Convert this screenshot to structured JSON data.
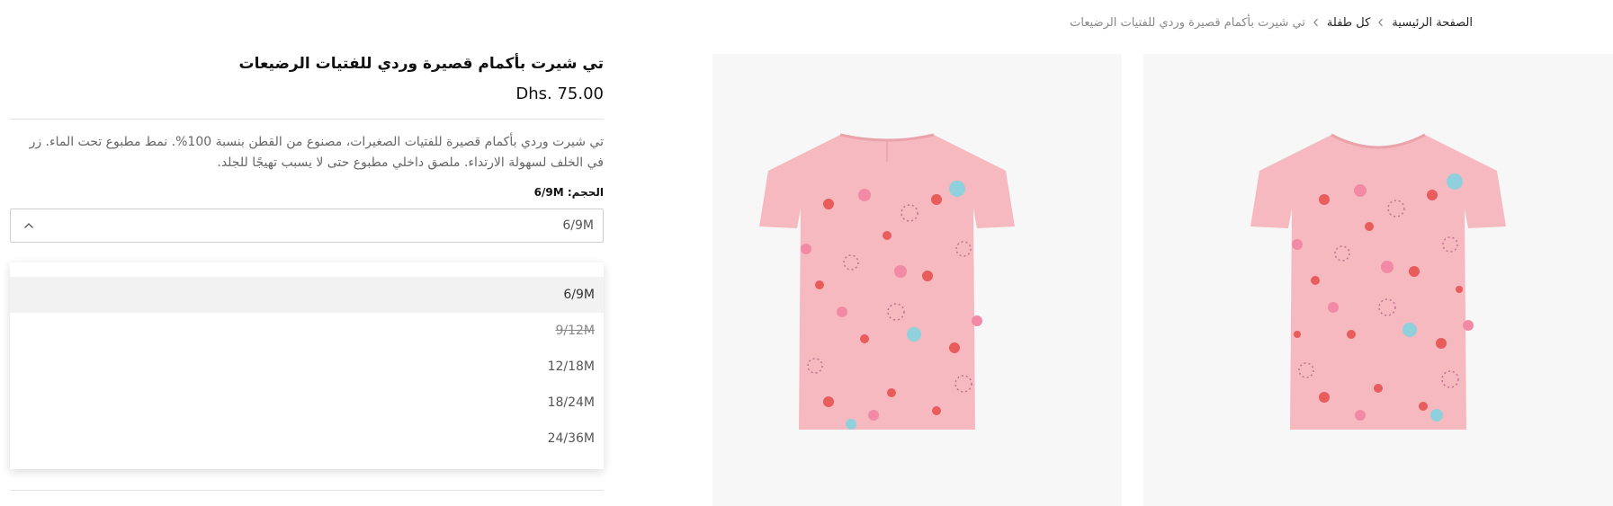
{
  "breadcrumb": {
    "home": "الصفحة الرئيسية",
    "category": "كل طفلة",
    "current": "تي شيرت بأكمام قصيرة وردي للفتيات الرضيعات"
  },
  "product": {
    "title": "تي شيرت بأكمام قصيرة وردي للفتيات الرضيعات",
    "price": "Dhs. 75.00",
    "description": "تي شيرت وردي بأكمام قصيرة للفتيات الصغيرات، مصنوع من القطن بنسبة 100%. نمط مطبوع تحت الماء. زر في الخلف لسهولة الارتداء. ملصق داخلي مطبوع حتى لا يسبب تهيجًا للجلد.",
    "size_label": "الحجم: 6/9M",
    "selected_size": "6/9M",
    "sizes": [
      {
        "label": "6/9M",
        "selected": true,
        "available": true
      },
      {
        "label": "9/12M",
        "selected": false,
        "available": false
      },
      {
        "label": "12/18M",
        "selected": false,
        "available": true
      },
      {
        "label": "18/24M",
        "selected": false,
        "available": true
      },
      {
        "label": "24/36M",
        "selected": false,
        "available": true
      }
    ]
  },
  "colors": {
    "shirt": "#f6b9c0",
    "photo_bg": "#f7f7f7"
  },
  "icons": {
    "breadcrumb_separator": "chevron-left-icon",
    "dropdown_toggle": "chevron-up-icon"
  }
}
